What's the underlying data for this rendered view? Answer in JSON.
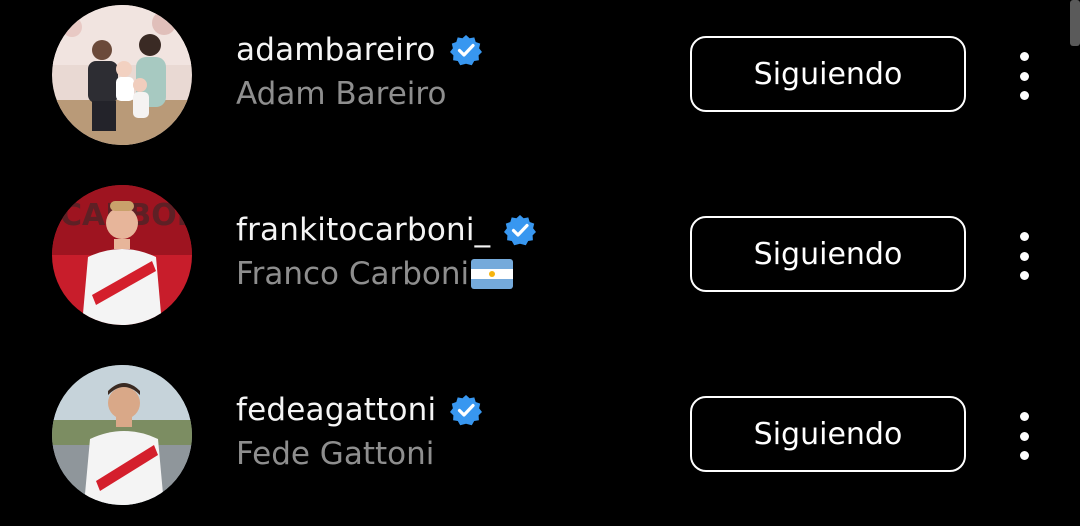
{
  "accent_color": "#3897f0",
  "accounts": [
    {
      "username": "adambareiro",
      "full_name": "Adam Bareiro",
      "verified": true,
      "follow_label": "Siguiendo",
      "more_icon": "more-vertical-icon"
    },
    {
      "username": "frankitocarboni_",
      "full_name": "Franco Carboni",
      "name_suffix_emoji": "argentina-flag",
      "verified": true,
      "follow_label": "Siguiendo",
      "more_icon": "more-vertical-icon"
    },
    {
      "username": "fedeagattoni",
      "full_name": "Fede Gattoni",
      "verified": true,
      "follow_label": "Siguiendo",
      "more_icon": "more-vertical-icon"
    }
  ]
}
